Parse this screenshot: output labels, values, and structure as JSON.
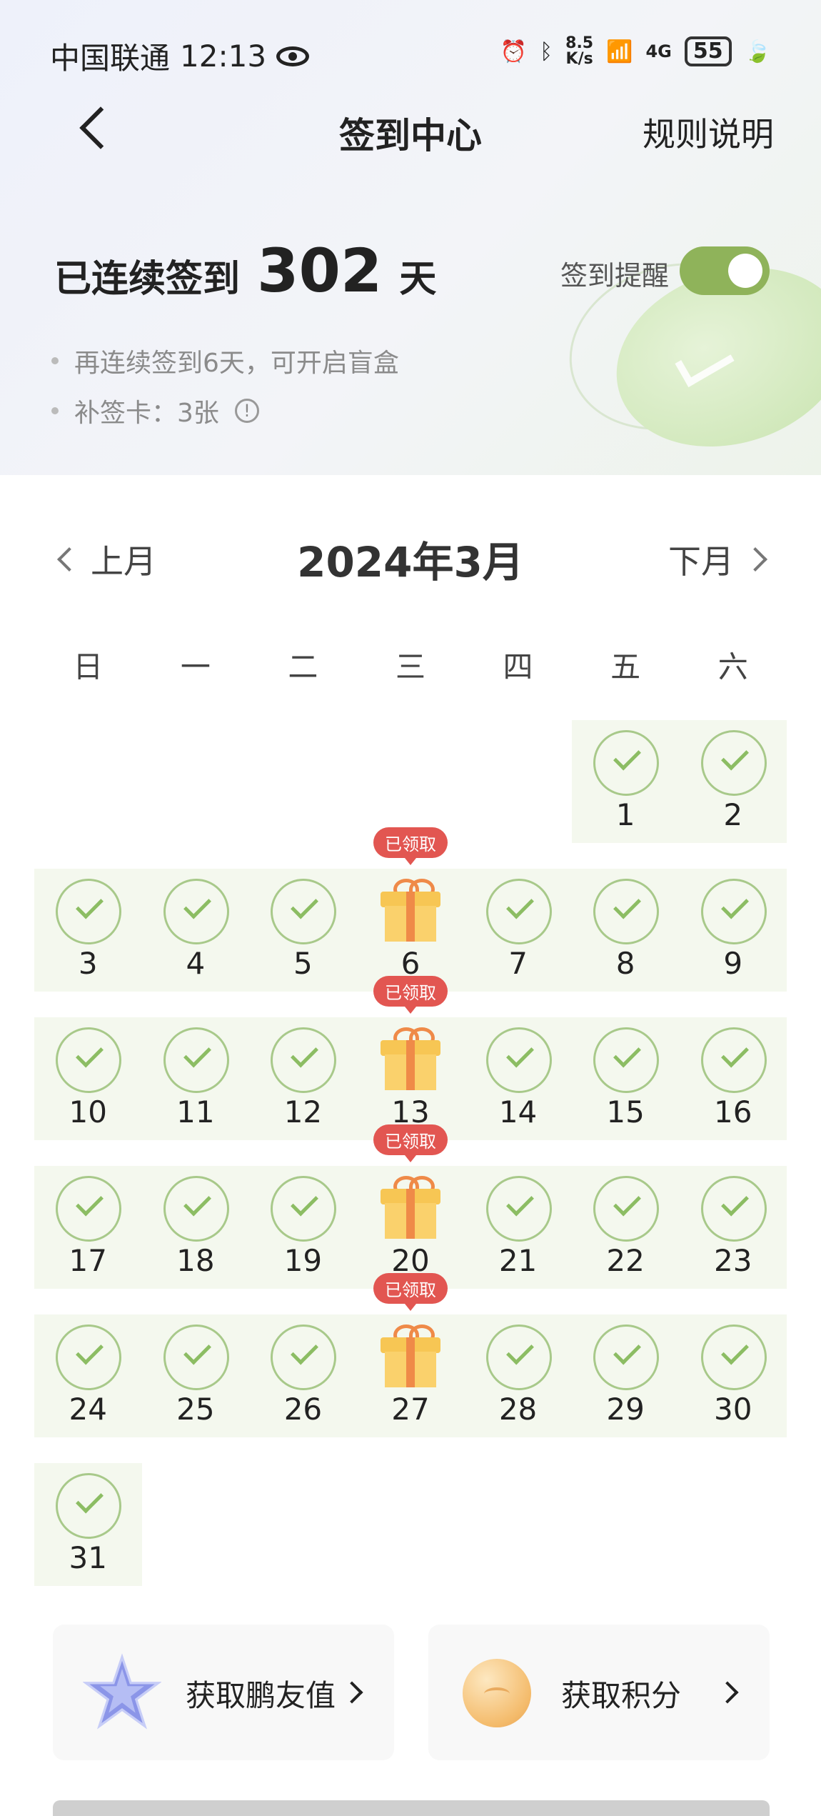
{
  "status_bar": {
    "carrier": "中国联通",
    "time": "12:13",
    "net_speed_value": "8.5",
    "net_speed_unit": "K/s",
    "network": "4G",
    "battery": "55"
  },
  "header": {
    "title": "签到中心",
    "rules_label": "规则说明"
  },
  "streak": {
    "prefix": "已连续签到",
    "days": "302",
    "suffix": "天",
    "reminder_label": "签到提醒",
    "reminder_on": true
  },
  "tips": {
    "blind_box": "再连续签到6天，可开启盲盒",
    "makeup_card": "补签卡：3张"
  },
  "calendar": {
    "prev_label": "上月",
    "next_label": "下月",
    "month_title": "2024年3月",
    "weekdays": [
      "日",
      "一",
      "二",
      "三",
      "四",
      "五",
      "六"
    ],
    "gift_badge": "已领取",
    "weeks": [
      [
        "",
        "",
        "",
        "",
        "",
        "1",
        "2"
      ],
      [
        "3",
        "4",
        "5",
        "6",
        "7",
        "8",
        "9"
      ],
      [
        "10",
        "11",
        "12",
        "13",
        "14",
        "15",
        "16"
      ],
      [
        "17",
        "18",
        "19",
        "20",
        "21",
        "22",
        "23"
      ],
      [
        "24",
        "25",
        "26",
        "27",
        "28",
        "29",
        "30"
      ],
      [
        "31",
        "",
        "",
        "",
        "",
        "",
        ""
      ]
    ]
  },
  "cards": {
    "friend_value": "获取鹏友值",
    "points": "获取积分"
  },
  "colors": {
    "accent_green": "#8fb35a",
    "badge_red": "#e25651",
    "check_green": "#8cbd63"
  }
}
